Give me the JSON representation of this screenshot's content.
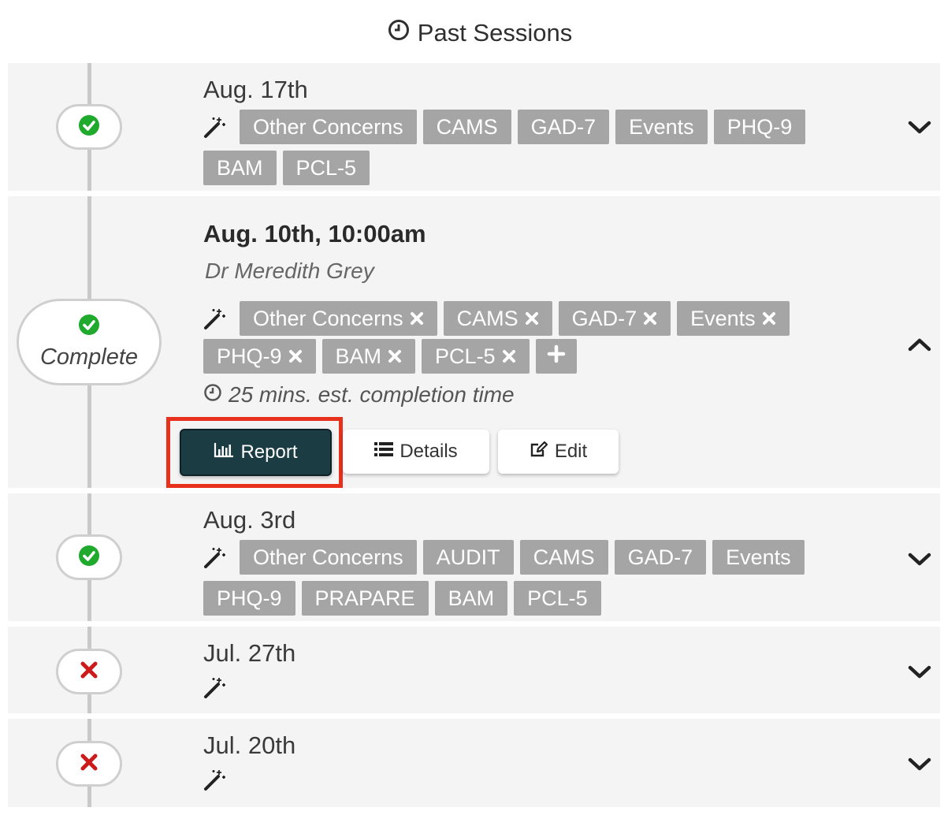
{
  "header": {
    "title": "Past Sessions",
    "icon": "clock-icon"
  },
  "colors": {
    "complete": "#1faa2d",
    "missed": "#cc1a1a",
    "tag": "#a5a5a5",
    "primary": "#1c3c44",
    "highlight": "#e8311c"
  },
  "sessions": [
    {
      "date": "Aug. 17th",
      "status": "complete",
      "tags": [
        "Other Concerns",
        "CAMS",
        "GAD-7",
        "Events",
        "PHQ-9",
        "BAM",
        "PCL-5"
      ]
    },
    {
      "date": "Aug. 10th, 10:00am",
      "status": "complete",
      "status_label": "Complete",
      "clinician": "Dr Meredith Grey",
      "tags": [
        "Other Concerns",
        "CAMS",
        "GAD-7",
        "Events",
        "PHQ-9",
        "BAM",
        "PCL-5"
      ],
      "estimate": "25 mins. est. completion time",
      "buttons": {
        "report": "Report",
        "details": "Details",
        "edit": "Edit"
      }
    },
    {
      "date": "Aug. 3rd",
      "status": "complete",
      "tags": [
        "Other Concerns",
        "AUDIT",
        "CAMS",
        "GAD-7",
        "Events",
        "PHQ-9",
        "PRAPARE",
        "BAM",
        "PCL-5"
      ]
    },
    {
      "date": "Jul. 27th",
      "status": "missed",
      "tags": []
    },
    {
      "date": "Jul. 20th",
      "status": "missed",
      "tags": []
    }
  ]
}
